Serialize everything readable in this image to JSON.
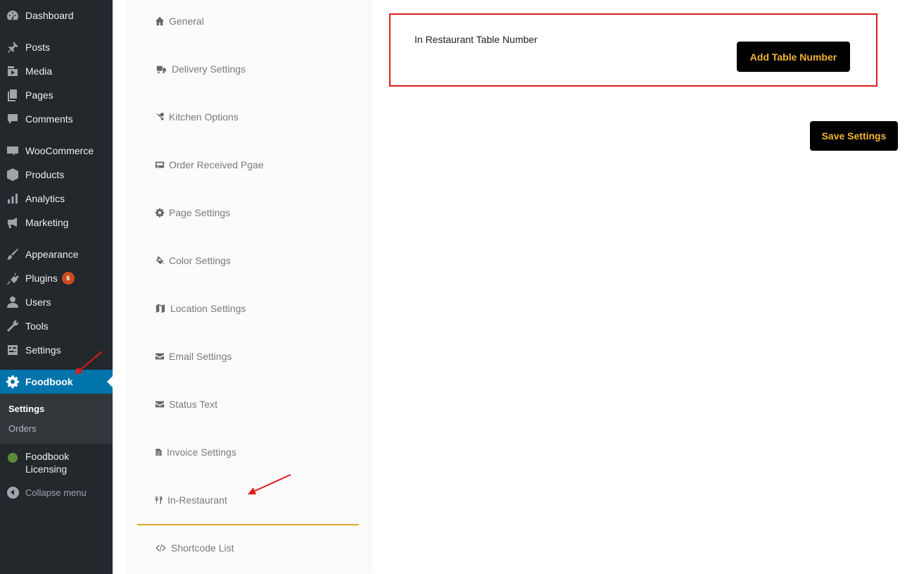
{
  "sidebar": {
    "items": [
      {
        "label": "Dashboard",
        "icon": "dashboard-icon"
      },
      {
        "label": "Posts",
        "icon": "pin-icon"
      },
      {
        "label": "Media",
        "icon": "media-icon"
      },
      {
        "label": "Pages",
        "icon": "pages-icon"
      },
      {
        "label": "Comments",
        "icon": "comment-icon"
      },
      {
        "label": "WooCommerce",
        "icon": "woo-icon"
      },
      {
        "label": "Products",
        "icon": "box-icon"
      },
      {
        "label": "Analytics",
        "icon": "bar-chart-icon"
      },
      {
        "label": "Marketing",
        "icon": "megaphone-icon"
      },
      {
        "label": "Appearance",
        "icon": "brush-icon"
      },
      {
        "label": "Plugins",
        "icon": "plug-icon",
        "badge": "6"
      },
      {
        "label": "Users",
        "icon": "user-icon"
      },
      {
        "label": "Tools",
        "icon": "wrench-icon"
      },
      {
        "label": "Settings",
        "icon": "sliders-icon"
      },
      {
        "label": "Foodbook",
        "icon": "gear-icon",
        "current": true
      }
    ],
    "submenu": [
      {
        "label": "Settings",
        "active": true
      },
      {
        "label": "Orders"
      }
    ],
    "licensing": {
      "line1": "Foodbook",
      "line2": "Licensing"
    },
    "collapse_label": "Collapse menu",
    "current_color": "#0073aa",
    "badge_color": "#ca4a1f"
  },
  "plugin_nav": {
    "items": [
      {
        "label": "General",
        "icon": "home-icon"
      },
      {
        "label": "Delivery Settings",
        "icon": "truck-icon"
      },
      {
        "label": "Kitchen Options",
        "icon": "tools-icon"
      },
      {
        "label": "Order Received Pgae",
        "icon": "card-icon"
      },
      {
        "label": "Page Settings",
        "icon": "cog-icon"
      },
      {
        "label": "Color Settings",
        "icon": "paint-bucket-icon"
      },
      {
        "label": "Location Settings",
        "icon": "map-icon"
      },
      {
        "label": "Email Settings",
        "icon": "envelope-icon"
      },
      {
        "label": "Status Text",
        "icon": "envelope-icon"
      },
      {
        "label": "Invoice Settings",
        "icon": "file-icon"
      },
      {
        "label": "In-Restaurant",
        "icon": "cutlery-icon",
        "active": true
      },
      {
        "label": "Shortcode List",
        "icon": "code-icon"
      }
    ],
    "active_color": "#e5a32c"
  },
  "main": {
    "table_label": "In Restaurant Table Number",
    "add_button": "Add Table Number",
    "save_button": "Save Settings",
    "highlight_color": "#dd1d1d",
    "button_text_color": "#f2b434"
  }
}
